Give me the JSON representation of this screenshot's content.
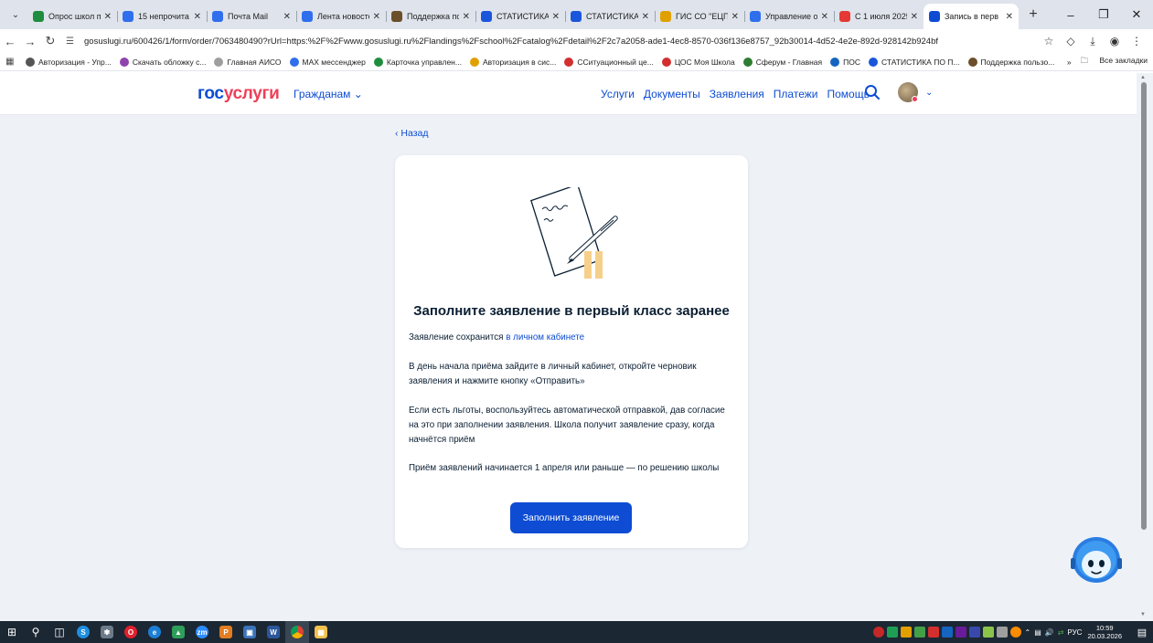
{
  "browser": {
    "tabs": [
      {
        "title": "Опрос школ п",
        "color": "#1e8e3e",
        "active": false
      },
      {
        "title": "15 непрочита",
        "color": "#2f6fed",
        "active": false
      },
      {
        "title": "Почта Mail",
        "color": "#2f6fed",
        "active": false
      },
      {
        "title": "Лента новосте",
        "color": "#2f6fed",
        "active": false
      },
      {
        "title": "Поддержка пс",
        "color": "#6b4f2a",
        "active": false
      },
      {
        "title": "СТАТИСТИКА",
        "color": "#1a56db",
        "active": false
      },
      {
        "title": "СТАТИСТИКА",
        "color": "#1a56db",
        "active": false
      },
      {
        "title": "ГИС СО \"ЕЦП\"",
        "color": "#e0a100",
        "active": false
      },
      {
        "title": "Управление о",
        "color": "#2f6fed",
        "active": false
      },
      {
        "title": "С 1 июля 2025",
        "color": "#e53935",
        "active": false
      },
      {
        "title": "Запись в перв",
        "color": "#0d4cd3",
        "active": true
      }
    ],
    "new_tab": "+",
    "url": "gosuslugi.ru/600426/1/form/order/7063480490?rUrl=https:%2F%2Fwww.gosuslugi.ru%2Flandings%2Fschool%2Fcatalog%2Fdetail%2F2c7a2058-ade1-4ec8-8570-036f136e8757_92b30014-4d52-4e2e-892d-928142b924bf",
    "bookmarks": [
      {
        "label": "Авторизация - Упр...",
        "color": "#555555"
      },
      {
        "label": "Скачать обложку с...",
        "color": "#8e44ad"
      },
      {
        "label": "Главная АИСО",
        "color": "#9e9e9e"
      },
      {
        "label": "MAX мессенджер",
        "color": "#2f6fed"
      },
      {
        "label": "Карточка управлен...",
        "color": "#1e8e3e"
      },
      {
        "label": "Авторизация в сис...",
        "color": "#e0a100"
      },
      {
        "label": "ССитуационный це...",
        "color": "#d32f2f"
      },
      {
        "label": "ЦОС Моя Школа",
        "color": "#d32f2f"
      },
      {
        "label": "Сферум - Главная",
        "color": "#2e7d32"
      },
      {
        "label": "ПОС",
        "color": "#1565c0"
      },
      {
        "label": "СТАТИСТИКА ПО П...",
        "color": "#1a56db"
      },
      {
        "label": "Поддержка пользо...",
        "color": "#6b4f2a"
      }
    ],
    "bookmarks_more": "»",
    "all_bookmarks": "Все закладки"
  },
  "header": {
    "logo_part1": "гос",
    "logo_part2": "услуги",
    "citizens": "Гражданам",
    "nav": [
      "Услуги",
      "Документы",
      "Заявления",
      "Платежи",
      "Помощь"
    ]
  },
  "main": {
    "back": "Назад",
    "title": "Заполните заявление в первый класс заранее",
    "p1_text": "Заявление сохранится ",
    "p1_link": "в личном кабинете",
    "p2": "В день начала приёма зайдите в личный кабинет, откройте черновик заявления и нажмите кнопку «Отправить»",
    "p3": "Если есть льготы, воспользуйтесь автоматической отправкой, дав согласие на это при заполнении заявления. Школа получит заявление сразу, когда начнётся приём",
    "p4": "Приём заявлений начинается 1 апреля или раньше — по решению школы",
    "button": "Заполнить заявление"
  },
  "taskbar": {
    "lang": "РУС",
    "time": "10:59",
    "date": "20.03.2026"
  },
  "colors": {
    "brand_blue": "#0d4cd3",
    "brand_red": "#ee3f58",
    "page_bg": "#eef2f7"
  }
}
